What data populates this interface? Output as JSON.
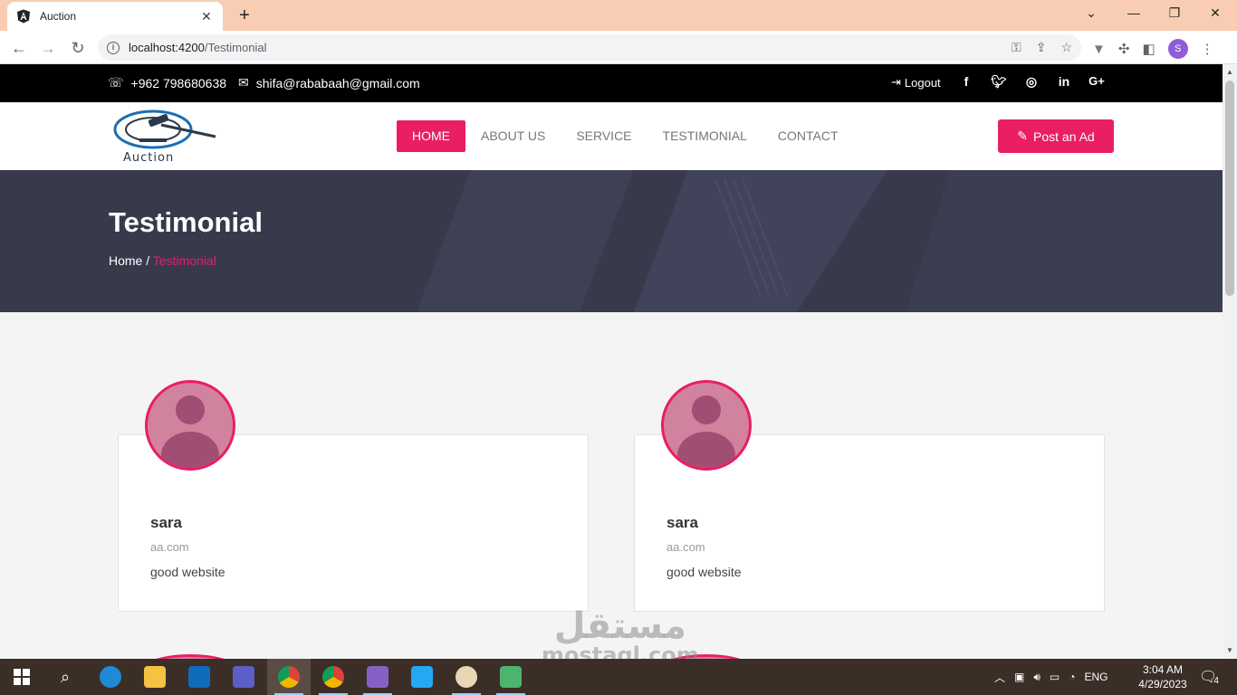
{
  "browser": {
    "tab_title": "Auction",
    "tab_close": "✕",
    "new_tab": "+",
    "url_host": "localhost:4200",
    "url_path": "/Testimonial",
    "profile_initial": "S",
    "window_controls": [
      "⌄",
      "—",
      "❐",
      "✕"
    ]
  },
  "topbar": {
    "phone": "+962 798680638",
    "email": "shifa@rababaah@gmail.com",
    "logout": "Logout",
    "social": [
      "facebook-icon",
      "twitter-icon",
      "instagram-icon",
      "linkedin-icon",
      "google-plus-icon"
    ]
  },
  "navbar": {
    "logo_text": "Auction",
    "menu": [
      "HOME",
      "ABOUT US",
      "SERVICE",
      "TESTIMONIAL",
      "CONTACT"
    ],
    "active_index": 0,
    "post_button": "Post an Ad"
  },
  "hero": {
    "title": "Testimonial",
    "breadcrumb_home": "Home",
    "breadcrumb_sep": "/",
    "breadcrumb_current": "Testimonial"
  },
  "testimonials": [
    {
      "name": "sara",
      "site": "aa.com",
      "text": "good website"
    },
    {
      "name": "sara",
      "site": "aa.com",
      "text": "good website"
    }
  ],
  "watermark": {
    "arabic": "مستقل",
    "latin": "mostaql.com"
  },
  "taskbar": {
    "apps": [
      "windows-start-icon",
      "search-icon",
      "edge-icon",
      "file-explorer-icon",
      "outlook-icon",
      "teams-icon",
      "chrome-icon",
      "chrome-icon",
      "visual-studio-icon",
      "vscode-icon",
      "paint-icon",
      "app-icon"
    ],
    "language": "ENG",
    "time": "3:04 AM",
    "date": "4/29/2023",
    "notifications": "4"
  },
  "colors": {
    "accent": "#e91e63",
    "topbar": "#000000",
    "hero": "#383a4c",
    "tab_strip": "#f8cdb3",
    "taskbar": "#3a2e27"
  }
}
